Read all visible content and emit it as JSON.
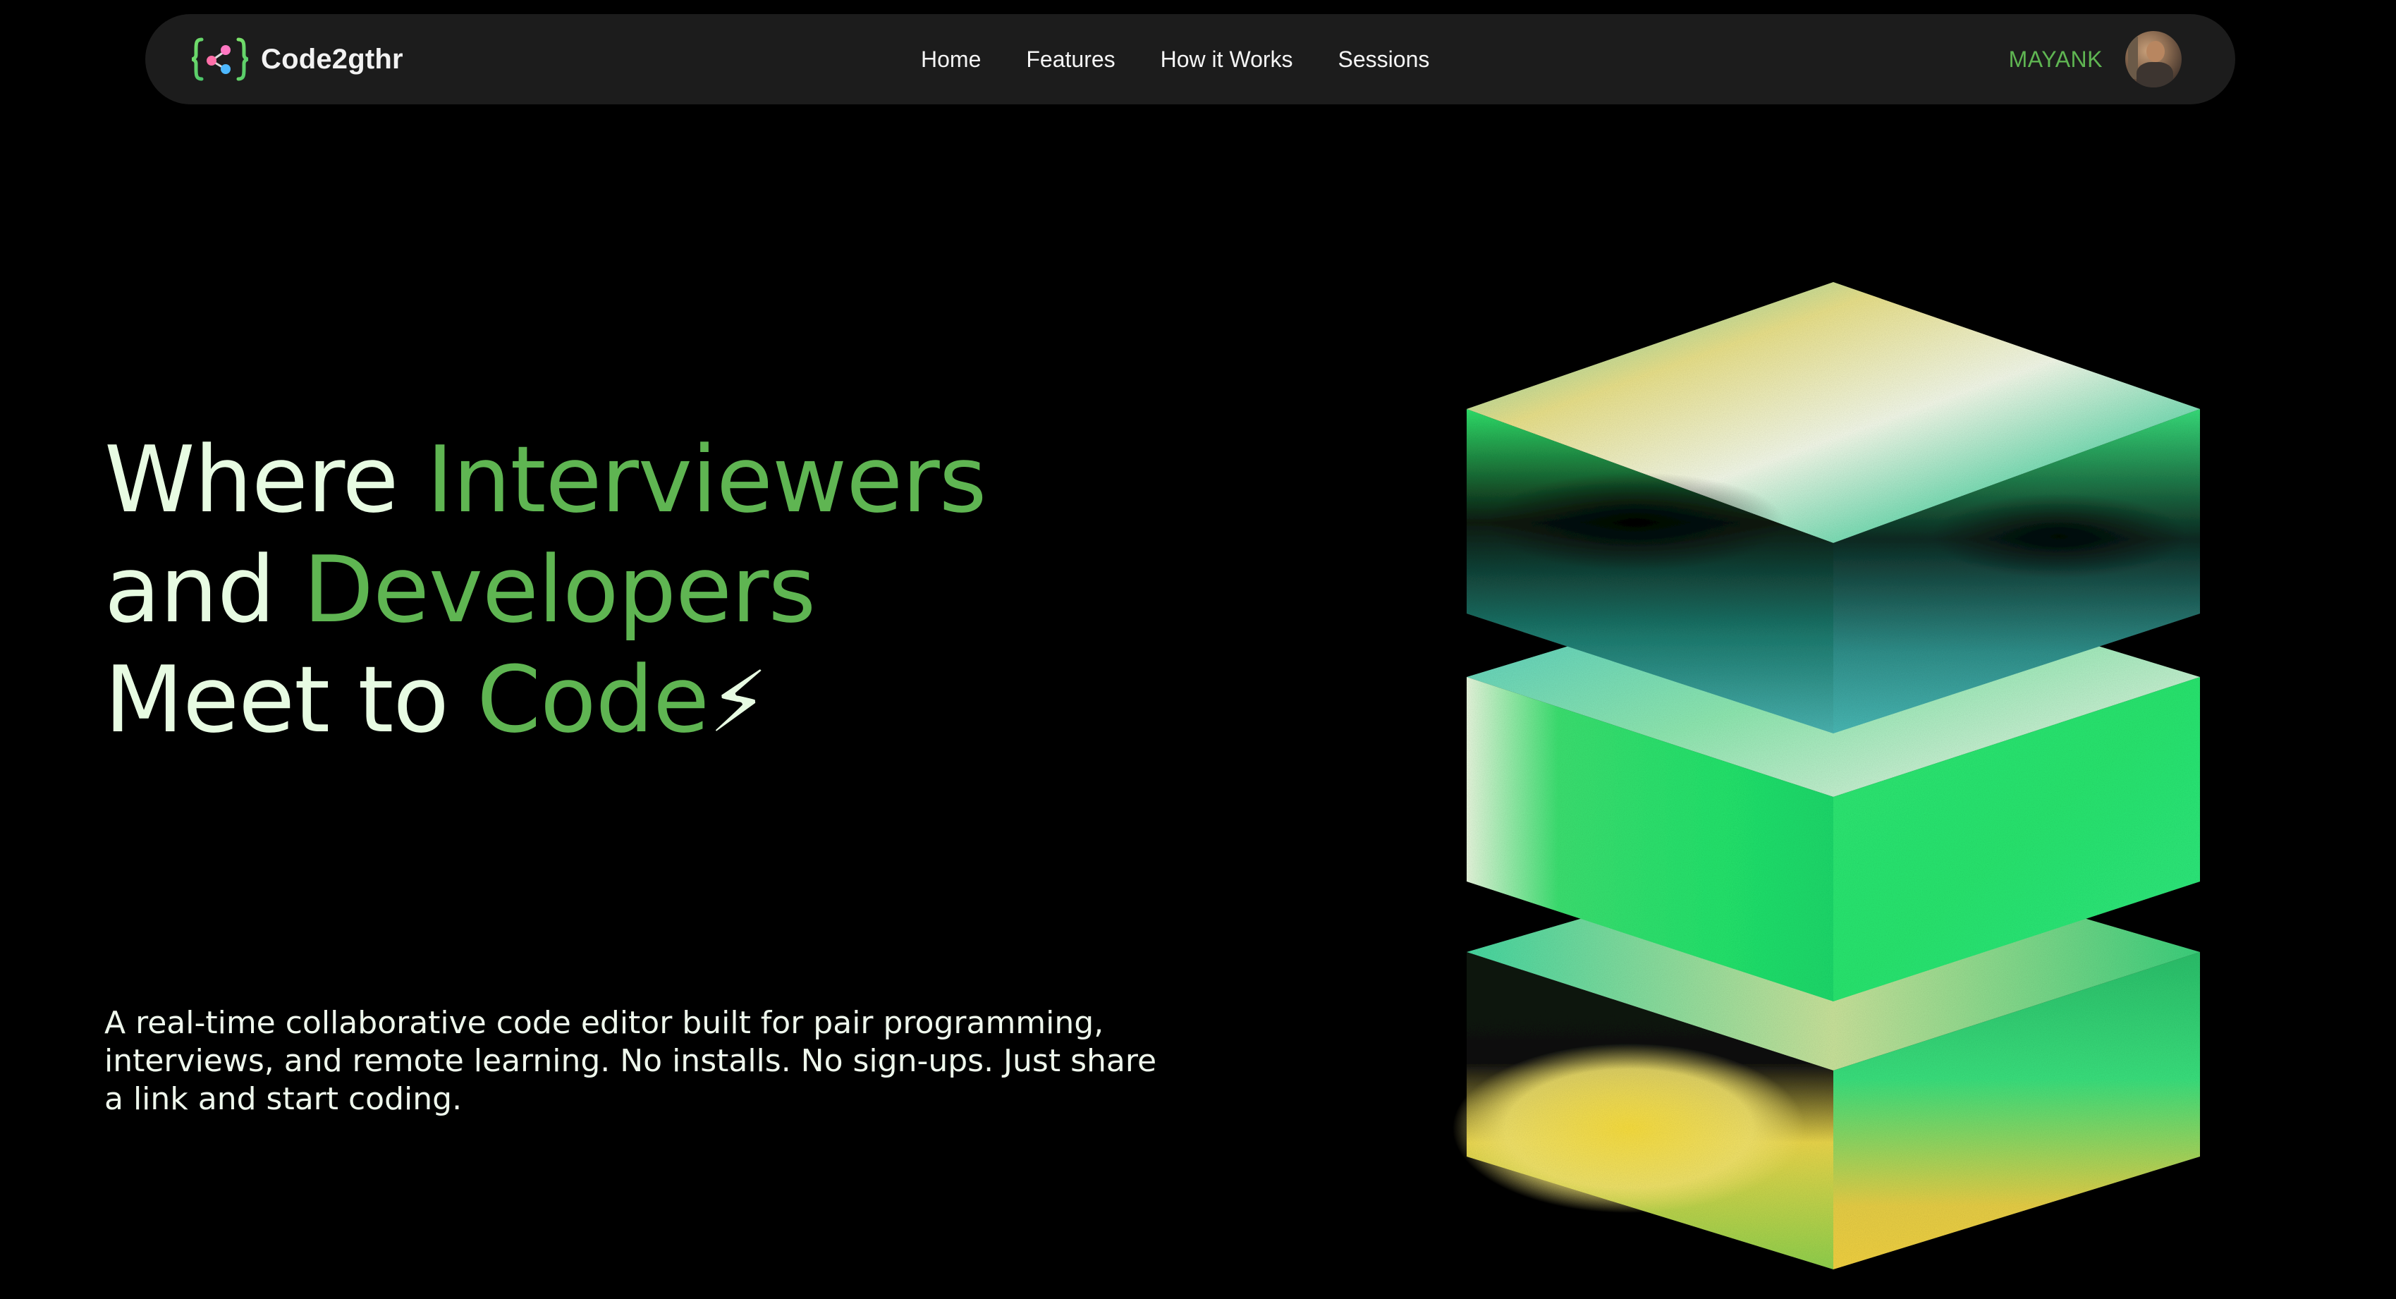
{
  "navbar": {
    "brand_name": "Code2gthr",
    "links": [
      "Home",
      "Features",
      "How it Works",
      "Sessions"
    ],
    "user_name": "MAYANK"
  },
  "hero": {
    "headline": {
      "line1_plain": "Where ",
      "line1_accent": "Interviewers",
      "line2_plain": "and ",
      "line2_accent": "Developers",
      "line3_plain": "Meet to ",
      "line3_accent": "Code",
      "line3_emoji": "⚡"
    },
    "subtitle": "A real-time collaborative code editor built for pair programming, interviews, and remote learning. No installs. No sign-ups. Just share a link and start coding."
  },
  "colors": {
    "background": "#000000",
    "navbar_bg": "#1c1c1c",
    "accent_green": "#5fb552",
    "headline_text": "#e7fbe2"
  },
  "icons": {
    "logo": "code-share-logo-icon",
    "avatar": "user-avatar"
  }
}
